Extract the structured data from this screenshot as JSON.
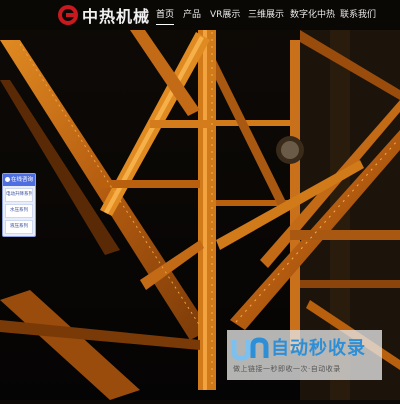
{
  "header": {
    "logo_text": "中热机械",
    "nav": [
      {
        "label": "首页",
        "active": true
      },
      {
        "label": "产品",
        "active": false
      },
      {
        "label": "VR展示",
        "active": false
      },
      {
        "label": "三维展示",
        "active": false
      },
      {
        "label": "数字化中热",
        "active": false
      },
      {
        "label": "联系我们",
        "active": false
      }
    ]
  },
  "hero": {
    "image_icon": "steel-truss-bridge-image"
  },
  "chat_widget": {
    "title": "在线咨询",
    "items": [
      "电动升降系列",
      "水压系列",
      "液压系列"
    ]
  },
  "watermark": {
    "title": "自动秒收录",
    "subtitle": "做上链接一秒即收一次·自动收录"
  },
  "colors": {
    "accent": "#c8191f",
    "steel": "#c86c14",
    "widget": "#4f6fe0",
    "watermark": "#2e8fd6"
  }
}
